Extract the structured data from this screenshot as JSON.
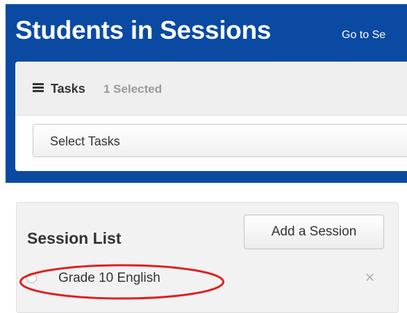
{
  "header": {
    "title": "Students in Sessions",
    "goto_link": "Go to Se"
  },
  "tasks": {
    "icon": "list-icon",
    "label": "Tasks",
    "selected_count": "1 Selected",
    "select_placeholder": "Select Tasks"
  },
  "session_list": {
    "title": "Session List",
    "add_button": "Add a Session",
    "items": [
      {
        "name": "Grade 10 English",
        "selected": false
      }
    ],
    "remove_icon": "close-icon"
  },
  "annotation": {
    "shape": "ellipse",
    "color": "#e02020",
    "target": "Grade 10 English"
  },
  "colors": {
    "header_bg": "#0a4aa3",
    "panel_bg": "#efefef",
    "muted_text": "#9a9a9a"
  }
}
